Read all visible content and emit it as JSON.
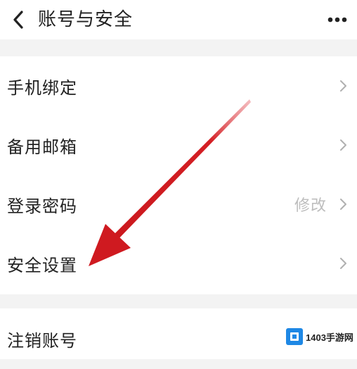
{
  "header": {
    "title": "账号与安全"
  },
  "settings": {
    "items": [
      {
        "label": "手机绑定",
        "value": ""
      },
      {
        "label": "备用邮箱",
        "value": ""
      },
      {
        "label": "登录密码",
        "value": "修改"
      },
      {
        "label": "安全设置",
        "value": ""
      }
    ],
    "bottom_items": [
      {
        "label": "注销账号"
      }
    ]
  },
  "watermark": {
    "text": "1403手游网"
  },
  "colors": {
    "accent_arrow": "#d41f24",
    "chevron": "#b0b0b0",
    "divider_bg": "#f3f3f3"
  }
}
